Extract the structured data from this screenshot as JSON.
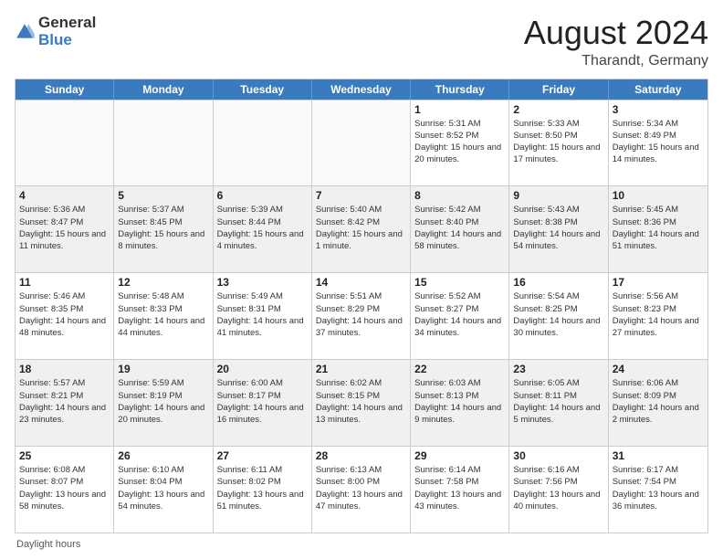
{
  "header": {
    "logo_general": "General",
    "logo_blue": "Blue",
    "title": "August 2024",
    "location": "Tharandt, Germany"
  },
  "days_of_week": [
    "Sunday",
    "Monday",
    "Tuesday",
    "Wednesday",
    "Thursday",
    "Friday",
    "Saturday"
  ],
  "footer": {
    "daylight_hours_label": "Daylight hours"
  },
  "weeks": [
    {
      "cells": [
        {
          "day": "",
          "empty": true
        },
        {
          "day": "",
          "empty": true
        },
        {
          "day": "",
          "empty": true
        },
        {
          "day": "",
          "empty": true
        },
        {
          "day": "1",
          "sunrise": "Sunrise: 5:31 AM",
          "sunset": "Sunset: 8:52 PM",
          "daylight": "Daylight: 15 hours and 20 minutes."
        },
        {
          "day": "2",
          "sunrise": "Sunrise: 5:33 AM",
          "sunset": "Sunset: 8:50 PM",
          "daylight": "Daylight: 15 hours and 17 minutes."
        },
        {
          "day": "3",
          "sunrise": "Sunrise: 5:34 AM",
          "sunset": "Sunset: 8:49 PM",
          "daylight": "Daylight: 15 hours and 14 minutes."
        }
      ]
    },
    {
      "cells": [
        {
          "day": "4",
          "sunrise": "Sunrise: 5:36 AM",
          "sunset": "Sunset: 8:47 PM",
          "daylight": "Daylight: 15 hours and 11 minutes."
        },
        {
          "day": "5",
          "sunrise": "Sunrise: 5:37 AM",
          "sunset": "Sunset: 8:45 PM",
          "daylight": "Daylight: 15 hours and 8 minutes."
        },
        {
          "day": "6",
          "sunrise": "Sunrise: 5:39 AM",
          "sunset": "Sunset: 8:44 PM",
          "daylight": "Daylight: 15 hours and 4 minutes."
        },
        {
          "day": "7",
          "sunrise": "Sunrise: 5:40 AM",
          "sunset": "Sunset: 8:42 PM",
          "daylight": "Daylight: 15 hours and 1 minute."
        },
        {
          "day": "8",
          "sunrise": "Sunrise: 5:42 AM",
          "sunset": "Sunset: 8:40 PM",
          "daylight": "Daylight: 14 hours and 58 minutes."
        },
        {
          "day": "9",
          "sunrise": "Sunrise: 5:43 AM",
          "sunset": "Sunset: 8:38 PM",
          "daylight": "Daylight: 14 hours and 54 minutes."
        },
        {
          "day": "10",
          "sunrise": "Sunrise: 5:45 AM",
          "sunset": "Sunset: 8:36 PM",
          "daylight": "Daylight: 14 hours and 51 minutes."
        }
      ]
    },
    {
      "cells": [
        {
          "day": "11",
          "sunrise": "Sunrise: 5:46 AM",
          "sunset": "Sunset: 8:35 PM",
          "daylight": "Daylight: 14 hours and 48 minutes."
        },
        {
          "day": "12",
          "sunrise": "Sunrise: 5:48 AM",
          "sunset": "Sunset: 8:33 PM",
          "daylight": "Daylight: 14 hours and 44 minutes."
        },
        {
          "day": "13",
          "sunrise": "Sunrise: 5:49 AM",
          "sunset": "Sunset: 8:31 PM",
          "daylight": "Daylight: 14 hours and 41 minutes."
        },
        {
          "day": "14",
          "sunrise": "Sunrise: 5:51 AM",
          "sunset": "Sunset: 8:29 PM",
          "daylight": "Daylight: 14 hours and 37 minutes."
        },
        {
          "day": "15",
          "sunrise": "Sunrise: 5:52 AM",
          "sunset": "Sunset: 8:27 PM",
          "daylight": "Daylight: 14 hours and 34 minutes."
        },
        {
          "day": "16",
          "sunrise": "Sunrise: 5:54 AM",
          "sunset": "Sunset: 8:25 PM",
          "daylight": "Daylight: 14 hours and 30 minutes."
        },
        {
          "day": "17",
          "sunrise": "Sunrise: 5:56 AM",
          "sunset": "Sunset: 8:23 PM",
          "daylight": "Daylight: 14 hours and 27 minutes."
        }
      ]
    },
    {
      "cells": [
        {
          "day": "18",
          "sunrise": "Sunrise: 5:57 AM",
          "sunset": "Sunset: 8:21 PM",
          "daylight": "Daylight: 14 hours and 23 minutes."
        },
        {
          "day": "19",
          "sunrise": "Sunrise: 5:59 AM",
          "sunset": "Sunset: 8:19 PM",
          "daylight": "Daylight: 14 hours and 20 minutes."
        },
        {
          "day": "20",
          "sunrise": "Sunrise: 6:00 AM",
          "sunset": "Sunset: 8:17 PM",
          "daylight": "Daylight: 14 hours and 16 minutes."
        },
        {
          "day": "21",
          "sunrise": "Sunrise: 6:02 AM",
          "sunset": "Sunset: 8:15 PM",
          "daylight": "Daylight: 14 hours and 13 minutes."
        },
        {
          "day": "22",
          "sunrise": "Sunrise: 6:03 AM",
          "sunset": "Sunset: 8:13 PM",
          "daylight": "Daylight: 14 hours and 9 minutes."
        },
        {
          "day": "23",
          "sunrise": "Sunrise: 6:05 AM",
          "sunset": "Sunset: 8:11 PM",
          "daylight": "Daylight: 14 hours and 5 minutes."
        },
        {
          "day": "24",
          "sunrise": "Sunrise: 6:06 AM",
          "sunset": "Sunset: 8:09 PM",
          "daylight": "Daylight: 14 hours and 2 minutes."
        }
      ]
    },
    {
      "cells": [
        {
          "day": "25",
          "sunrise": "Sunrise: 6:08 AM",
          "sunset": "Sunset: 8:07 PM",
          "daylight": "Daylight: 13 hours and 58 minutes."
        },
        {
          "day": "26",
          "sunrise": "Sunrise: 6:10 AM",
          "sunset": "Sunset: 8:04 PM",
          "daylight": "Daylight: 13 hours and 54 minutes."
        },
        {
          "day": "27",
          "sunrise": "Sunrise: 6:11 AM",
          "sunset": "Sunset: 8:02 PM",
          "daylight": "Daylight: 13 hours and 51 minutes."
        },
        {
          "day": "28",
          "sunrise": "Sunrise: 6:13 AM",
          "sunset": "Sunset: 8:00 PM",
          "daylight": "Daylight: 13 hours and 47 minutes."
        },
        {
          "day": "29",
          "sunrise": "Sunrise: 6:14 AM",
          "sunset": "Sunset: 7:58 PM",
          "daylight": "Daylight: 13 hours and 43 minutes."
        },
        {
          "day": "30",
          "sunrise": "Sunrise: 6:16 AM",
          "sunset": "Sunset: 7:56 PM",
          "daylight": "Daylight: 13 hours and 40 minutes."
        },
        {
          "day": "31",
          "sunrise": "Sunrise: 6:17 AM",
          "sunset": "Sunset: 7:54 PM",
          "daylight": "Daylight: 13 hours and 36 minutes."
        }
      ]
    }
  ]
}
